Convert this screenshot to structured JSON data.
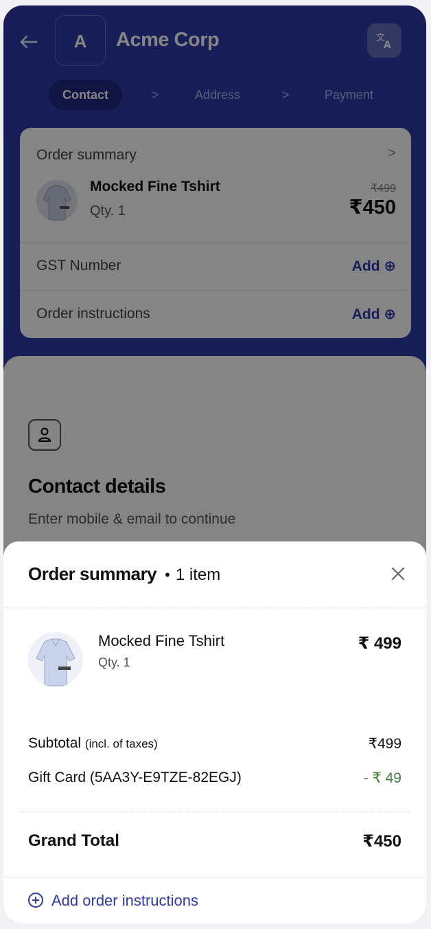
{
  "header": {
    "back_icon": "arrow-left-icon",
    "logo_letter": "A",
    "brand_name": "Acme Corp",
    "language_icon": "translate-icon"
  },
  "steps": [
    {
      "label": "Contact",
      "active": true
    },
    {
      "label": "Address",
      "active": false
    },
    {
      "label": "Payment",
      "active": false
    }
  ],
  "summary_card": {
    "title": "Order summary",
    "item_name": "Mocked Fine Tshirt",
    "item_qty": "Qty. 1",
    "old_price": "₹499",
    "new_price": "₹450",
    "rows": [
      {
        "label": "GST Number",
        "action": "Add ⊕"
      },
      {
        "label": "Order instructions",
        "action": "Add ⊕"
      }
    ]
  },
  "contact": {
    "icon": "person-icon",
    "title": "Contact details",
    "subtitle": "Enter mobile & email to continue"
  },
  "sheet": {
    "title": "Order summary",
    "dot": "•",
    "count": "1 item",
    "close_icon": "close-icon",
    "item": {
      "name": "Mocked Fine Tshirt",
      "qty": "Qty. 1",
      "price": "₹ 499"
    },
    "subtotal": {
      "label": "Subtotal",
      "note": "(incl. of taxes)",
      "value": "₹499"
    },
    "gift_card": {
      "label": "Gift Card (5AA3Y-E9TZE-82EGJ)",
      "value": "- ₹ 49"
    },
    "grand_total": {
      "label": "Grand Total",
      "value": "₹450"
    },
    "add_instructions": "Add order instructions"
  },
  "colors": {
    "brand": "#2f3aa9",
    "active_step": "#1e2780",
    "discount": "#3f7c3a"
  }
}
